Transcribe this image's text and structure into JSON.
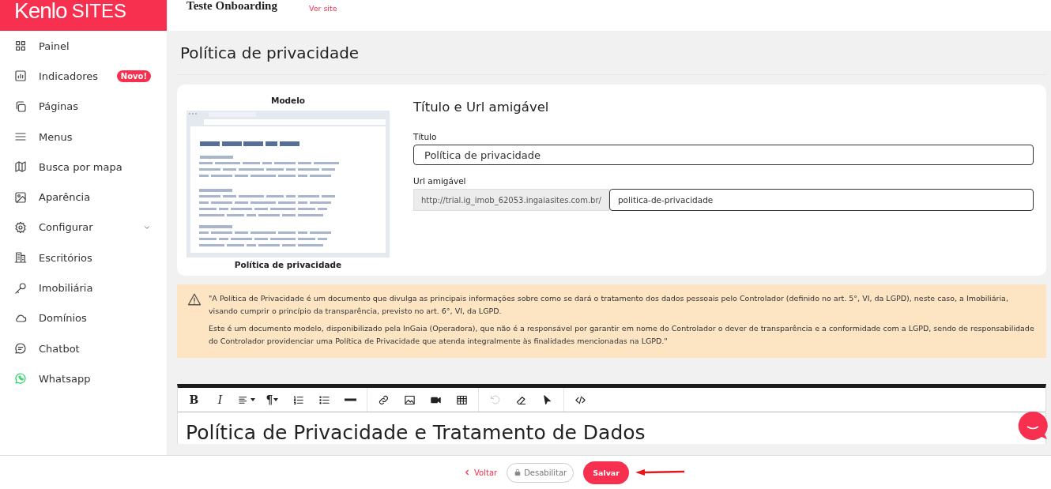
{
  "logo": {
    "text": "Kenlo",
    "suffix": "SITES"
  },
  "header": {
    "site_name": "Teste Onboarding",
    "view_link": "Ver site"
  },
  "sidebar": {
    "items": [
      {
        "label": "Painel",
        "selected": false
      },
      {
        "label": "Indicadores",
        "selected": false,
        "badge": "Novo!"
      },
      {
        "label": "Páginas",
        "selected": false
      },
      {
        "label": "Menus",
        "selected": false
      },
      {
        "label": "Busca por mapa",
        "selected": false
      },
      {
        "label": "Aparência",
        "selected": false
      },
      {
        "label": "Configurar",
        "selected": false,
        "expanded": false
      },
      {
        "label": "Escritórios",
        "selected": false
      },
      {
        "label": "Imobiliária",
        "selected": false
      },
      {
        "label": "Domínios",
        "selected": false
      },
      {
        "label": "Chatbot",
        "selected": false
      },
      {
        "label": "Whatsapp",
        "selected": false
      }
    ]
  },
  "page_title": "Política de privacidade",
  "template": {
    "heading": "Modelo",
    "caption": "Política de privacidade"
  },
  "form": {
    "heading": "Título e Url amigável",
    "title_label": "Título",
    "title_value": "Política de privacidade",
    "url_label": "Url amigável",
    "url_prefix": "http://trial.ig_imob_62053.ingaiasites.com.br/",
    "url_value": "politica-de-privacidade"
  },
  "notice": {
    "paragraphs": [
      "\"A Política de Privacidade é um documento que divulga as principais informações sobre como se dará o tratamento dos dados pessoais pelo Controlador (definido no art. 5°, VI, da LGPD), neste caso, a Imobiliária, visando cumprir o princípio da transparência, previsto no art. 6°, VI, da LGPD.",
      "Este é um documento modelo, disponibilizado pela InGaia (Operadora), que não é a responsável por garantir em nome do Controlador o dever de transparência e a conformidade com a LGPD, sendo de responsabilidade do Controlador providenciar uma Política de Privacidade que atenda integralmente às finalidades mencionadas na LGPD.\""
    ]
  },
  "editor": {
    "toolbar": [
      [
        {
          "kind": "text",
          "label": "B",
          "disabled": false
        },
        {
          "kind": "text",
          "label": "I",
          "disabled": false
        },
        {
          "kind": "icon",
          "disabled": false
        },
        {
          "kind": "text",
          "label": "¶",
          "disabled": false
        },
        {
          "kind": "icon",
          "disabled": false
        },
        {
          "kind": "icon",
          "disabled": false
        },
        {
          "kind": "icon",
          "disabled": false
        }
      ],
      [
        {
          "kind": "icon",
          "disabled": false
        },
        {
          "kind": "icon",
          "disabled": false
        },
        {
          "kind": "icon",
          "disabled": false
        },
        {
          "kind": "icon",
          "disabled": false
        }
      ],
      [
        {
          "kind": "icon",
          "disabled": true
        },
        {
          "kind": "icon",
          "disabled": false
        },
        {
          "kind": "icon",
          "disabled": false
        }
      ],
      [
        {
          "kind": "icon",
          "disabled": false
        }
      ]
    ],
    "content_heading": "Política de Privacidade e Tratamento de Dados"
  },
  "footer": {
    "back": "Voltar",
    "disable": {
      "label": "Desabilitar",
      "disabled": true
    },
    "save": "Salvar"
  }
}
